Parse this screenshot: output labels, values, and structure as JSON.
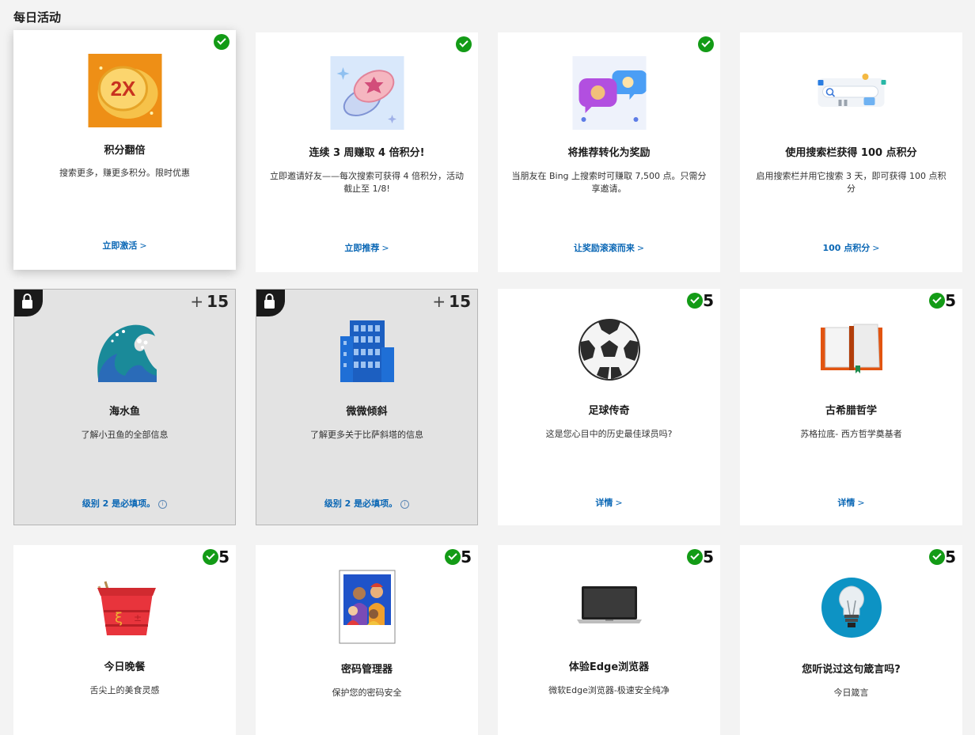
{
  "section": {
    "title": "每日活动"
  },
  "row1": [
    {
      "title": "积分翻倍",
      "desc": "搜索更多，赚更多积分。限时优惠",
      "link": "立即激活"
    },
    {
      "title": "连续 3 周赚取 4 倍积分!",
      "desc": "立即邀请好友——每次搜索可获得 4 倍积分，活动截止至 1/8!",
      "link": "立即推荐"
    },
    {
      "title": "将推荐转化为奖励",
      "desc": "当朋友在 Bing 上搜索时可赚取 7,500 点。只需分享邀请。",
      "link": "让奖励滚滚而来"
    },
    {
      "title": "使用搜索栏获得 100 点积分",
      "desc": "启用搜索栏并用它搜索 3 天，即可获得 100 点积分",
      "link": "100 点积分"
    }
  ],
  "row2": [
    {
      "title": "海水鱼",
      "desc": "了解小丑鱼的全部信息",
      "link": "级别 2 是必填项。",
      "points": "15",
      "icon": "wave-icon"
    },
    {
      "title": "微微倾斜",
      "desc": "了解更多关于比萨斜塔的信息",
      "link": "级别 2 是必填项。",
      "points": "15",
      "icon": "building-icon"
    },
    {
      "title": "足球传奇",
      "desc": "这是您心目中的历史最佳球员吗?",
      "link": "详情",
      "points": "5",
      "icon": "soccer-ball-icon"
    },
    {
      "title": "古希腊哲学",
      "desc": "苏格拉底- 西方哲学奠基者",
      "link": "详情",
      "points": "5",
      "icon": "open-book-icon"
    }
  ],
  "row3": [
    {
      "title": "今日晚餐",
      "desc": "舌尖上的美食灵感",
      "points": "5",
      "icon": "takeout-box-icon"
    },
    {
      "title": "密码管理器",
      "desc": "保护您的密码安全",
      "points": "5",
      "icon": "family-photo-icon"
    },
    {
      "title": "体验Edge浏览器",
      "desc": "微软Edge浏览器-极速安全纯净",
      "points": "5",
      "icon": "laptop-icon"
    },
    {
      "title": "您听说过这句箴言吗?",
      "desc": "今日箴言",
      "points": "5",
      "icon": "lightbulb-icon"
    }
  ],
  "symbols": {
    "plus": "+",
    "chevron": ">",
    "info": "i"
  },
  "colors": {
    "accent_link": "#0a67b5",
    "check_green": "#139b16",
    "locked_bg": "#e3e3e3"
  }
}
